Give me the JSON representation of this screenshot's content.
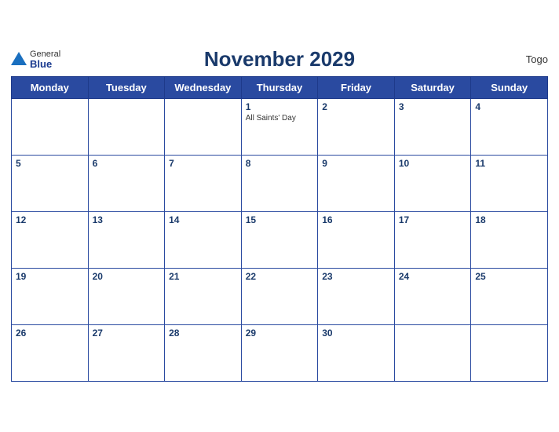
{
  "brand": {
    "general": "General",
    "blue": "Blue",
    "triangle_color": "#1a6fbf"
  },
  "title": "November 2029",
  "country": "Togo",
  "weekdays": [
    "Monday",
    "Tuesday",
    "Wednesday",
    "Thursday",
    "Friday",
    "Saturday",
    "Sunday"
  ],
  "weeks": [
    [
      {
        "day": "",
        "event": ""
      },
      {
        "day": "",
        "event": ""
      },
      {
        "day": "",
        "event": ""
      },
      {
        "day": "1",
        "event": "All Saints' Day"
      },
      {
        "day": "2",
        "event": ""
      },
      {
        "day": "3",
        "event": ""
      },
      {
        "day": "4",
        "event": ""
      }
    ],
    [
      {
        "day": "5",
        "event": ""
      },
      {
        "day": "6",
        "event": ""
      },
      {
        "day": "7",
        "event": ""
      },
      {
        "day": "8",
        "event": ""
      },
      {
        "day": "9",
        "event": ""
      },
      {
        "day": "10",
        "event": ""
      },
      {
        "day": "11",
        "event": ""
      }
    ],
    [
      {
        "day": "12",
        "event": ""
      },
      {
        "day": "13",
        "event": ""
      },
      {
        "day": "14",
        "event": ""
      },
      {
        "day": "15",
        "event": ""
      },
      {
        "day": "16",
        "event": ""
      },
      {
        "day": "17",
        "event": ""
      },
      {
        "day": "18",
        "event": ""
      }
    ],
    [
      {
        "day": "19",
        "event": ""
      },
      {
        "day": "20",
        "event": ""
      },
      {
        "day": "21",
        "event": ""
      },
      {
        "day": "22",
        "event": ""
      },
      {
        "day": "23",
        "event": ""
      },
      {
        "day": "24",
        "event": ""
      },
      {
        "day": "25",
        "event": ""
      }
    ],
    [
      {
        "day": "26",
        "event": ""
      },
      {
        "day": "27",
        "event": ""
      },
      {
        "day": "28",
        "event": ""
      },
      {
        "day": "29",
        "event": ""
      },
      {
        "day": "30",
        "event": ""
      },
      {
        "day": "",
        "event": ""
      },
      {
        "day": "",
        "event": ""
      }
    ]
  ]
}
